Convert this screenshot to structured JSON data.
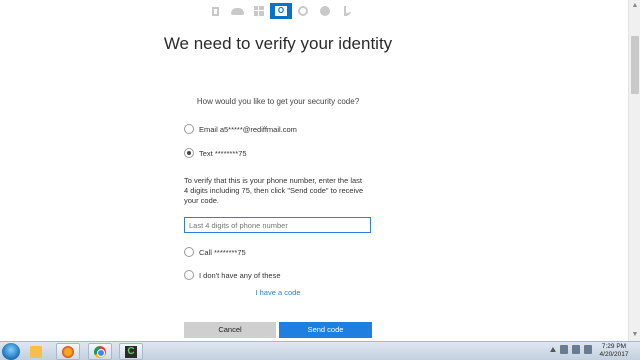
{
  "header": {
    "app_icons": [
      "office-icon",
      "onedrive-icon",
      "windows-icon",
      "outlook-icon",
      "xbox-icon",
      "skype-icon",
      "bing-icon"
    ],
    "outlook_glyph": "O"
  },
  "main": {
    "title": "We need to verify your identity",
    "question": "How would you like to get your security code?",
    "options": [
      {
        "label": "Email a5*****@rediffmail.com",
        "checked": false
      },
      {
        "label": "Text ********75",
        "checked": true
      },
      {
        "label": "Call ********75",
        "checked": false
      },
      {
        "label": "I don't have any of these",
        "checked": false
      }
    ],
    "instructions": "To verify that this is your phone number, enter the last 4 digits including 75, then click \"Send code\" to receive your code.",
    "phone_input": {
      "value": "",
      "placeholder": "Last 4 digits of phone number"
    },
    "have_code_link": "I have a code",
    "cancel_label": "Cancel",
    "send_label": "Send code"
  },
  "taskbar": {
    "items": [
      "explorer-icon",
      "media-player-icon",
      "firefox-icon",
      "chrome-icon",
      "camtasia-icon"
    ],
    "camtasia_glyph": "C",
    "clock_time": "7:29 PM",
    "clock_date": "4/20/2017"
  },
  "colors": {
    "accent": "#1e7fe0",
    "outlook_blue": "#0a72c6",
    "link": "#2f7ed8",
    "cancel_bg": "#cfcfcf"
  }
}
